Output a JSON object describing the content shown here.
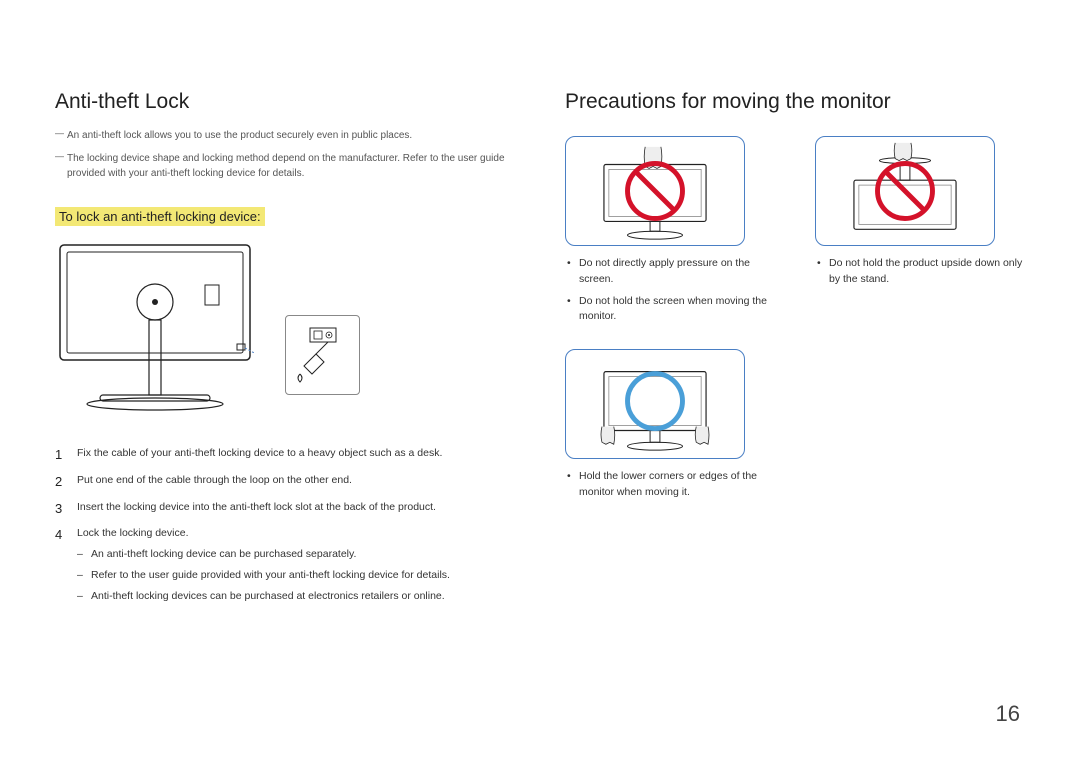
{
  "left": {
    "heading": "Anti-theft Lock",
    "note1": "An anti-theft lock allows you to use the product securely even in public places.",
    "note2": "The locking device shape and locking method depend on the manufacturer. Refer to the user guide provided with your anti-theft locking device for details.",
    "subheading": "To lock an anti-theft locking device:",
    "steps": {
      "s1": "Fix the cable of your anti-theft locking device to a heavy object such as a desk.",
      "s2": "Put one end of the cable through the loop on the other end.",
      "s3": "Insert the locking device into the anti-theft lock slot at the back of the product.",
      "s4": "Lock the locking device.",
      "s4a": "An anti-theft locking device can be purchased separately.",
      "s4b": "Refer to the user guide provided with your anti-theft locking device for details.",
      "s4c": "Anti-theft locking devices can be purchased at electronics retailers or online."
    }
  },
  "right": {
    "heading": "Precautions for moving the monitor",
    "row1": {
      "b1": "Do not directly apply pressure on the screen.",
      "b2": "Do not hold the screen when moving the monitor.",
      "b3": "Do not hold the product upside down only by the stand."
    },
    "row2": {
      "b1": "Hold the lower corners or edges of the monitor when moving it."
    }
  },
  "page_number": "16"
}
